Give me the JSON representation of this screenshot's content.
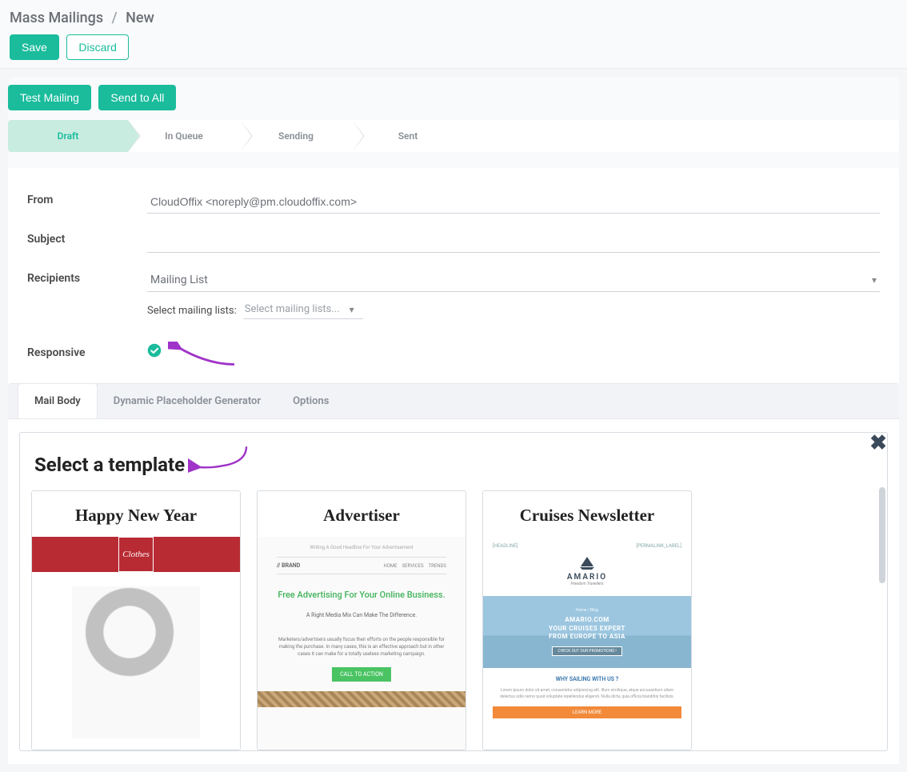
{
  "breadcrumb": {
    "root": "Mass Mailings",
    "separator": "/",
    "current": "New"
  },
  "actions": {
    "save": "Save",
    "discard": "Discard",
    "test_mailing": "Test Mailing",
    "send_all": "Send to All"
  },
  "pipeline": [
    "Draft",
    "In Queue",
    "Sending",
    "Sent"
  ],
  "form": {
    "from_label": "From",
    "from_value": "CloudOffix <noreply@pm.cloudoffix.com>",
    "subject_label": "Subject",
    "subject_value": "",
    "recipients_label": "Recipients",
    "recipients_value": "Mailing List",
    "select_lists_label": "Select mailing lists:",
    "select_lists_placeholder": "Select mailing lists...",
    "responsive_label": "Responsive"
  },
  "tabs": [
    "Mail Body",
    "Dynamic Placeholder Generator",
    "Options"
  ],
  "templates": {
    "heading": "Select a template",
    "items": [
      {
        "title": "Happy New Year",
        "logo_text": "Clothes"
      },
      {
        "title": "Advertiser",
        "tagline": "Writing A Good Headline For Your Advertisement",
        "brand": "// BRAND",
        "nav0": "HOME",
        "nav1": "SERVICES",
        "nav2": "TRENDS",
        "hero": "Free Advertising For Your Online Business.",
        "sub": "A Right Media Mix Can Make The Difference.",
        "para": "Marketers/advertisers usually focus their efforts on the people responsible for making the purchase. In many cases, this is an effective approach but in other cases it can make for a totally useless marketing campaign.",
        "cta": "CALL TO ACTION"
      },
      {
        "title": "Cruises Newsletter",
        "tag_left": "[HEADLINE]",
        "tag_right": "[PERMALINK_LABEL]",
        "brand": "AMARIO",
        "brand_sub": "Freedom Travellers",
        "hero_bc": "Home / Blog",
        "hero_line1": "AMARIO.COM",
        "hero_line2": "YOUR CRUISES EXPERT",
        "hero_line3": "FROM EUROPE TO ASIA",
        "hero_btn": "CHECK OUT OUR PROMOTIONS !",
        "section_h": "WHY SAILING WITH US ?",
        "section_p": "Lorem ipsum dolor sit amet, consectetur adipisicing elit. Illum similique, atque accusantium ullam delectus odio nemo quod voluptate repellendus eligendi. Nulla dicta, quia officia blanditiis facilisis.",
        "cta": "LEARN MORE"
      }
    ]
  }
}
